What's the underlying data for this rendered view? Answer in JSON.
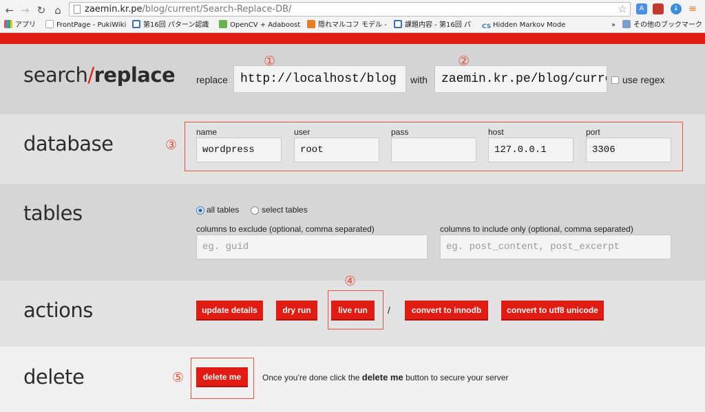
{
  "browser": {
    "url_host": "zaemin.kr.pe",
    "url_path": "/blog/current/Search-Replace-DB/",
    "bookmarks": [
      "アプリ",
      "FrontPage - PukiWiki",
      "第16回 パターン認識",
      "OpenCV + Adaboost",
      "隠れマルコフ モデル -",
      "課題内容 - 第16回 パ",
      "Hidden Markov Mode",
      "»",
      "その他のブックマーク"
    ]
  },
  "brand": {
    "part1": "search",
    "slash": "/",
    "part2": "replace"
  },
  "replace_row": {
    "replace_label": "replace",
    "replace_value": "http://localhost/blog",
    "with_label": "with",
    "with_value": "zaemin.kr.pe/blog/curre",
    "regex_label": "use regex"
  },
  "database": {
    "title": "database",
    "fields": [
      {
        "label": "name",
        "value": "wordpress"
      },
      {
        "label": "user",
        "value": "root"
      },
      {
        "label": "pass",
        "value": ""
      },
      {
        "label": "host",
        "value": "127.0.0.1"
      },
      {
        "label": "port",
        "value": "3306"
      }
    ]
  },
  "tables": {
    "title": "tables",
    "radio_all": "all tables",
    "radio_select": "select tables",
    "exclude_label": "columns to exclude (optional, comma separated)",
    "exclude_placeholder": "eg. guid",
    "include_label": "columns to include only (optional, comma separated)",
    "include_placeholder": "eg. post_content, post_excerpt"
  },
  "actions": {
    "title": "actions",
    "update": "update details",
    "dry": "dry run",
    "live": "live run",
    "separator": "/",
    "innodb": "convert to innodb",
    "utf8": "convert to utf8 unicode"
  },
  "delete": {
    "title": "delete",
    "button": "delete me",
    "msg_before": "Once you’re done click the ",
    "msg_bold": "delete me",
    "msg_after": " button to secure your server"
  },
  "annotations": [
    "①",
    "②",
    "③",
    "④",
    "⑤"
  ],
  "colors": {
    "accent": "#e31c13",
    "annotation": "#e8503c"
  }
}
